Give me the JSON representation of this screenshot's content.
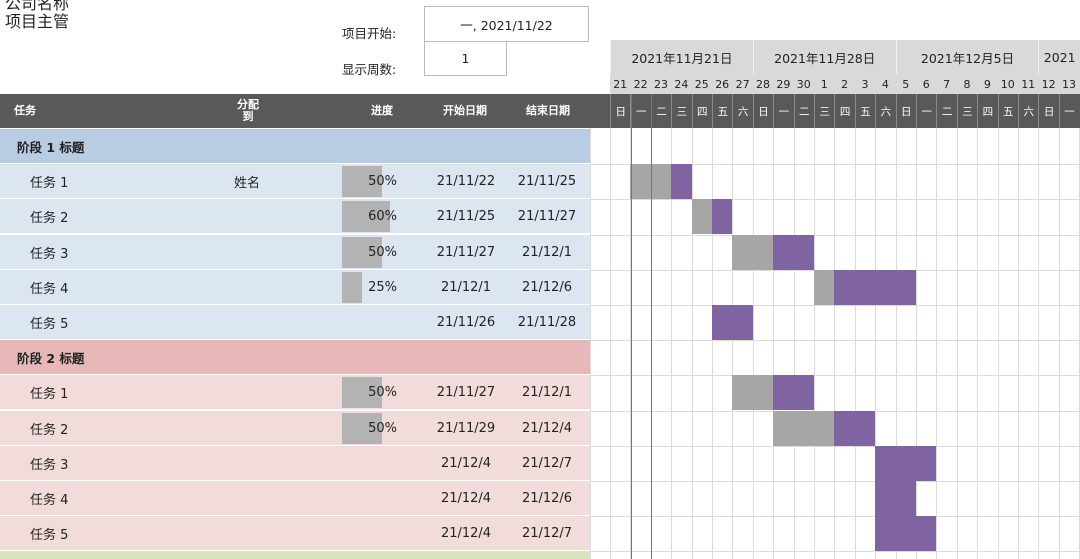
{
  "header": {
    "company": "公司名称",
    "manager": "项目主管",
    "project_start_label": "项目开始:",
    "project_start_value": "一, 2021/11/22",
    "display_weeks_label": "显示周数:",
    "display_weeks_value": "1"
  },
  "columns": {
    "task": "任务",
    "assigned": "分配\n到",
    "progress": "进度",
    "start": "开始日期",
    "end": "结束日期"
  },
  "weeks": [
    "2021年11月21日",
    "2021年11月28日",
    "2021年12月5日",
    "2021"
  ],
  "day_numbers": [
    "21",
    "22",
    "23",
    "24",
    "25",
    "26",
    "27",
    "28",
    "29",
    "30",
    "1",
    "2",
    "3",
    "4",
    "5",
    "6",
    "7",
    "8",
    "9",
    "10",
    "11",
    "12",
    "13"
  ],
  "day_of_week": [
    "日",
    "一",
    "二",
    "三",
    "四",
    "五",
    "六",
    "日",
    "一",
    "二",
    "三",
    "四",
    "五",
    "六",
    "日",
    "一",
    "二",
    "三",
    "四",
    "五",
    "六",
    "日",
    "一"
  ],
  "phases": [
    {
      "title": "阶段 1 标题",
      "colors": {
        "header": "#b8cce4",
        "row": "#dce6f1"
      },
      "tasks": [
        {
          "name": "任务 1",
          "assigned": "姓名",
          "progress": "50%",
          "progress_fraction": 0.5,
          "start": "21/11/22",
          "end": "21/11/25"
        },
        {
          "name": "任务 2",
          "assigned": "",
          "progress": "60%",
          "progress_fraction": 0.6,
          "start": "21/11/25",
          "end": "21/11/27"
        },
        {
          "name": "任务 3",
          "assigned": "",
          "progress": "50%",
          "progress_fraction": 0.5,
          "start": "21/11/27",
          "end": "21/12/1"
        },
        {
          "name": "任务 4",
          "assigned": "",
          "progress": "25%",
          "progress_fraction": 0.25,
          "start": "21/12/1",
          "end": "21/12/6"
        },
        {
          "name": "任务 5",
          "assigned": "",
          "progress": "",
          "progress_fraction": 0,
          "start": "21/11/26",
          "end": "21/11/28"
        }
      ]
    },
    {
      "title": "阶段 2 标题",
      "colors": {
        "header": "#e6b9b8",
        "row": "#f2dcdb"
      },
      "tasks": [
        {
          "name": "任务 1",
          "assigned": "",
          "progress": "50%",
          "progress_fraction": 0.5,
          "start": "21/11/27",
          "end": "21/12/1"
        },
        {
          "name": "任务 2",
          "assigned": "",
          "progress": "50%",
          "progress_fraction": 0.5,
          "start": "21/11/29",
          "end": "21/12/4"
        },
        {
          "name": "任务 3",
          "assigned": "",
          "progress": "",
          "progress_fraction": 0,
          "start": "21/12/4",
          "end": "21/12/7"
        },
        {
          "name": "任务 4",
          "assigned": "",
          "progress": "",
          "progress_fraction": 0,
          "start": "21/12/4",
          "end": "21/12/6"
        },
        {
          "name": "任务 5",
          "assigned": "",
          "progress": "",
          "progress_fraction": 0,
          "start": "21/12/4",
          "end": "21/12/7"
        }
      ]
    }
  ],
  "next_phase_color": "#d8e4bc",
  "gantt_colors": {
    "done": "#a6a6a6",
    "remaining": "#8064a2",
    "today_line": "#d05050"
  },
  "gantt_start_day": "2021-11-21",
  "today": "2021-11-22"
}
